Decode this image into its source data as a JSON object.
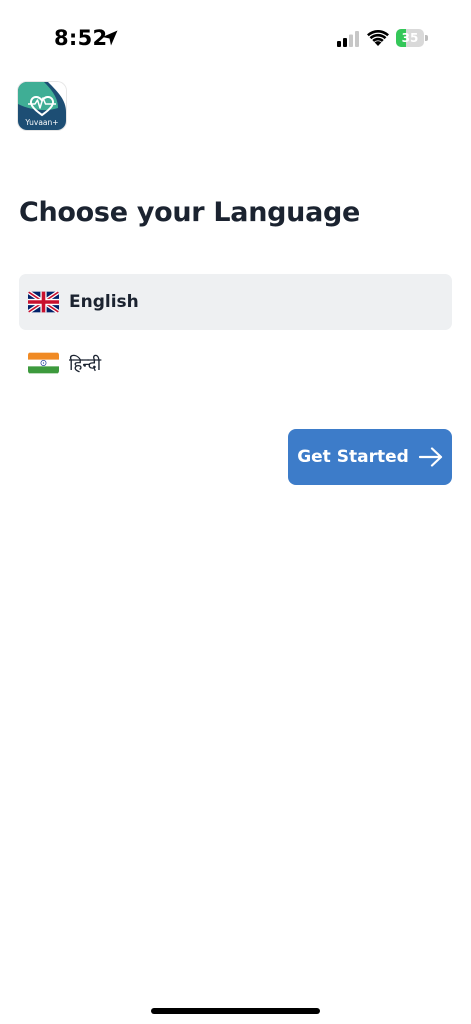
{
  "status_bar": {
    "time": "8:52",
    "battery_level": "35",
    "battery_fraction": 0.35,
    "icons": [
      "location-arrow-icon",
      "signal-icon",
      "wifi-icon",
      "battery-charging-icon"
    ]
  },
  "logo": {
    "caption": "Yuvaan+",
    "colors": {
      "top": "#3fae95",
      "bottom": "#1d4e74"
    }
  },
  "title": "Choose your Language",
  "languages": [
    {
      "label": "English",
      "flag": "uk-flag-icon",
      "selected": true
    },
    {
      "label": "हिन्दी",
      "flag": "india-flag-icon",
      "selected": false
    }
  ],
  "button": {
    "label": "Get Started",
    "icon": "arrow-right-icon",
    "color": "#3d7cc9"
  },
  "colors": {
    "selected_row": "#eef0f2",
    "text": "#1b2330"
  }
}
